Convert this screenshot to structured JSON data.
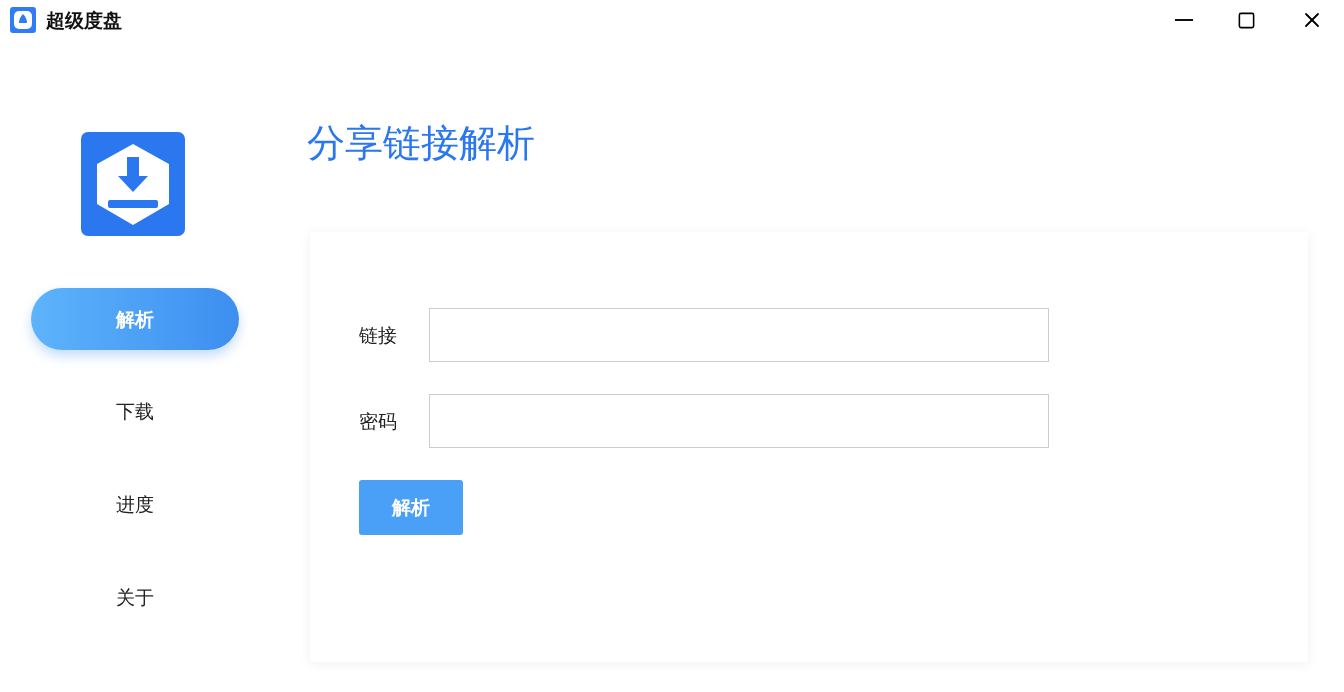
{
  "window": {
    "title": "超级度盘"
  },
  "sidebar": {
    "items": [
      {
        "label": "解析",
        "selected": true
      },
      {
        "label": "下载",
        "selected": false
      },
      {
        "label": "进度",
        "selected": false
      },
      {
        "label": "关于",
        "selected": false
      }
    ]
  },
  "page": {
    "title": "分享链接解析"
  },
  "form": {
    "fields": [
      {
        "label": "链接"
      },
      {
        "label": "密码"
      }
    ],
    "submit": "解析"
  }
}
